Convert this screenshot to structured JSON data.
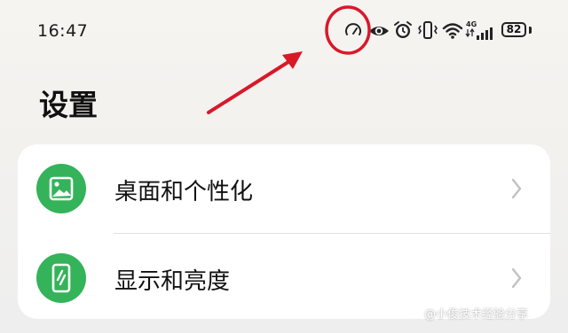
{
  "status_bar": {
    "time": "16:47",
    "network_label": "4G",
    "battery_level": "82",
    "icons": [
      "speedometer-icon",
      "eye-icon",
      "alarm-icon",
      "vibrate-icon",
      "wifi-icon",
      "signal-icon",
      "battery-icon"
    ]
  },
  "header": {
    "title": "设置"
  },
  "settings_items": [
    {
      "label": "桌面和个性化",
      "icon": "image-icon",
      "icon_color": "#34b35a"
    },
    {
      "label": "显示和亮度",
      "icon": "phone-brightness-icon",
      "icon_color": "#34b35a"
    }
  ],
  "annotation": {
    "circle_color": "#d8192a",
    "arrow_color": "#d8192a"
  },
  "watermark": {
    "text": "@小俊技术经验分享"
  }
}
